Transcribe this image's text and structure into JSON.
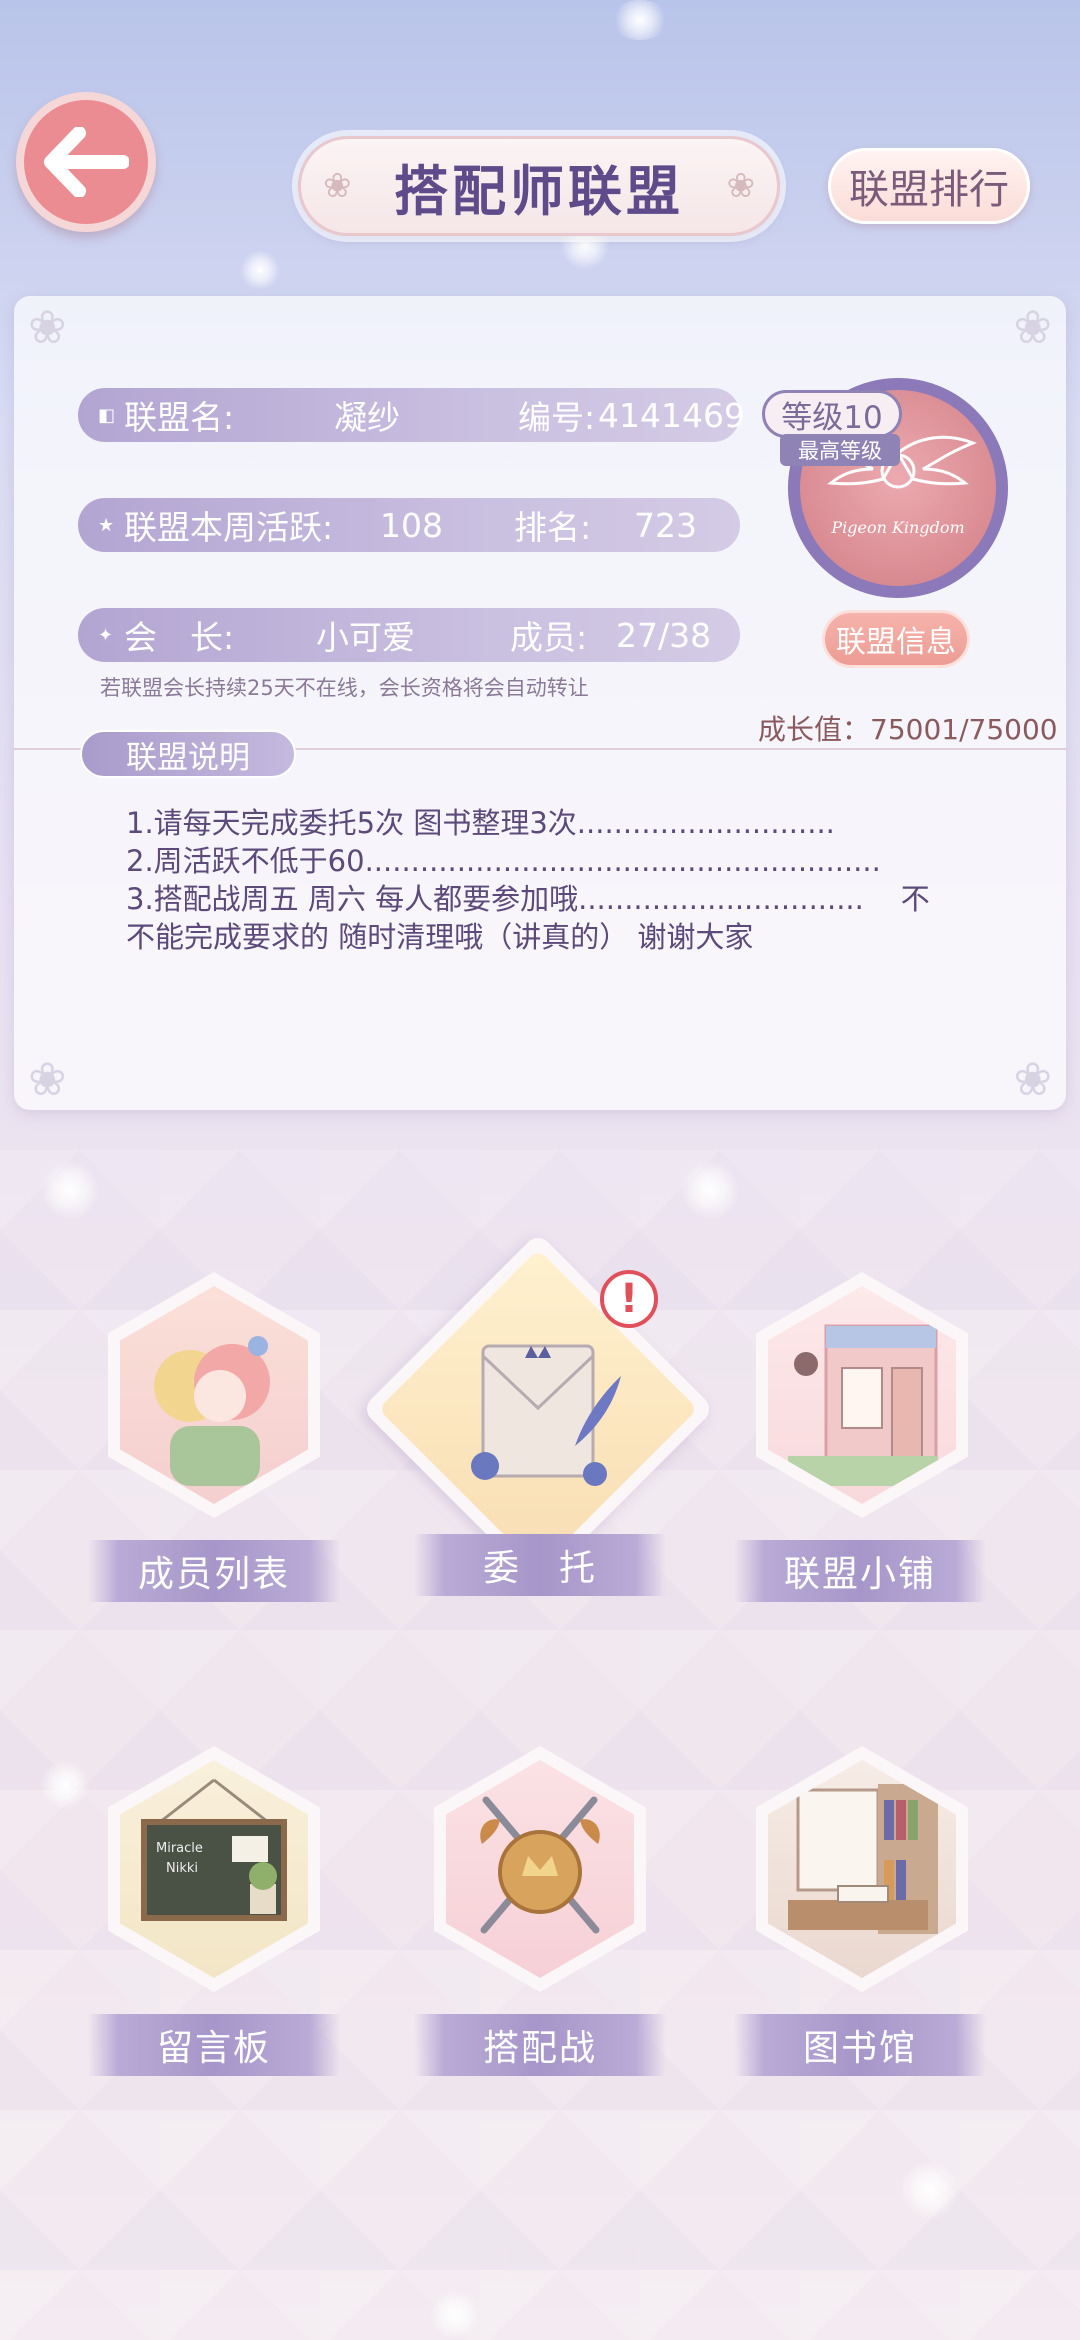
{
  "header": {
    "title": "搭配师联盟",
    "rank_button": "联盟排行"
  },
  "info": {
    "name_label": "联盟名:",
    "name_value": "凝纱",
    "id_label": "编号:",
    "id_value": "4141469",
    "activity_label": "联盟本周活跃:",
    "activity_value": "108",
    "rank_label": "排名:",
    "rank_value": "723",
    "leader_label": "会　长:",
    "leader_value": "小可爱",
    "members_label": "成员:",
    "members_value": "27/38",
    "note": "若联盟会长持续25天不在线，会长资格将会自动转让",
    "level": "等级10",
    "max_level": "最高等级",
    "emblem_text": "Pigeon Kingdom",
    "info_button": "联盟信息",
    "growth": "成长值：75001/75000"
  },
  "description": {
    "tab": "联盟说明",
    "text": "1.请每天完成委托5次 图书整理3次............................\n2.周活跃不低于60........................................................\n3.搭配战周五 周六 每人都要参加哦...............................    不\n不能完成要求的 随时清理哦（讲真的） 谢谢大家"
  },
  "menu": [
    {
      "label": "成员列表"
    },
    {
      "label": "委　托"
    },
    {
      "label": "联盟小铺"
    },
    {
      "label": "留言板"
    },
    {
      "label": "搭配战"
    },
    {
      "label": "图书馆"
    }
  ],
  "board_text": {
    "line1": "Miracle",
    "line2": "Nikki"
  },
  "colors": {
    "accent": "#a696c9",
    "back_button": "#ea8c91",
    "alert": "#e0505a"
  }
}
